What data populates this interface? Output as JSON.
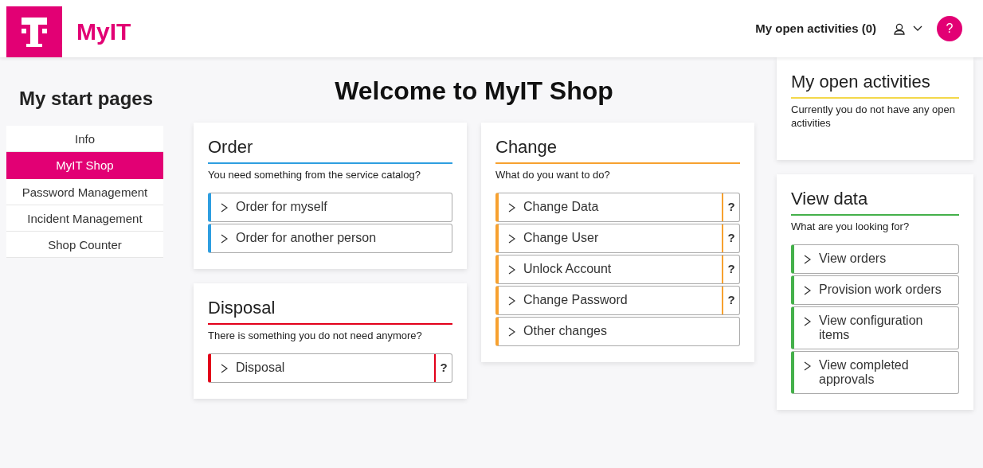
{
  "header": {
    "logo_text": "MyIT",
    "activities_link": "My open activities (0)",
    "help_label": "?"
  },
  "sidebar": {
    "title": "My start pages",
    "items": [
      {
        "label": "Info",
        "selected": false
      },
      {
        "label": "MyIT Shop",
        "selected": true
      },
      {
        "label": "Password Management",
        "selected": false
      },
      {
        "label": "Incident Management",
        "selected": false
      },
      {
        "label": "Shop Counter",
        "selected": false
      }
    ]
  },
  "page_title": "Welcome to MyIT Shop",
  "columns": [
    [
      {
        "title": "Order",
        "color": "#2e9ee0",
        "subtitle": "You need something from the service catalog?",
        "items": [
          {
            "label": "Order for myself"
          },
          {
            "label": "Order for another person"
          }
        ]
      },
      {
        "title": "Disposal",
        "color": "#e2001a",
        "subtitle": "There is something you do not need anymore?",
        "items": [
          {
            "label": "Disposal",
            "help_label": "?"
          }
        ]
      }
    ],
    [
      {
        "title": "Change",
        "color": "#f7a12f",
        "subtitle": "What do you want to do?",
        "items": [
          {
            "label": "Change Data",
            "help_label": "?"
          },
          {
            "label": "Change User",
            "help_label": "?"
          },
          {
            "label": "Unlock Account",
            "help_label": "?"
          },
          {
            "label": "Change Password",
            "help_label": "?"
          },
          {
            "label": "Other changes"
          }
        ]
      }
    ],
    [
      {
        "title": "My open activities",
        "color": "#f3d84a",
        "subtitle": "Currently you do not have any open activities"
      },
      {
        "title": "View data",
        "color": "#44b04a",
        "subtitle": "What are you looking for?",
        "items": [
          {
            "label": "View orders"
          },
          {
            "label": "Provision work orders"
          },
          {
            "label": "View configuration items"
          },
          {
            "label": "View completed approvals"
          }
        ]
      }
    ]
  ]
}
